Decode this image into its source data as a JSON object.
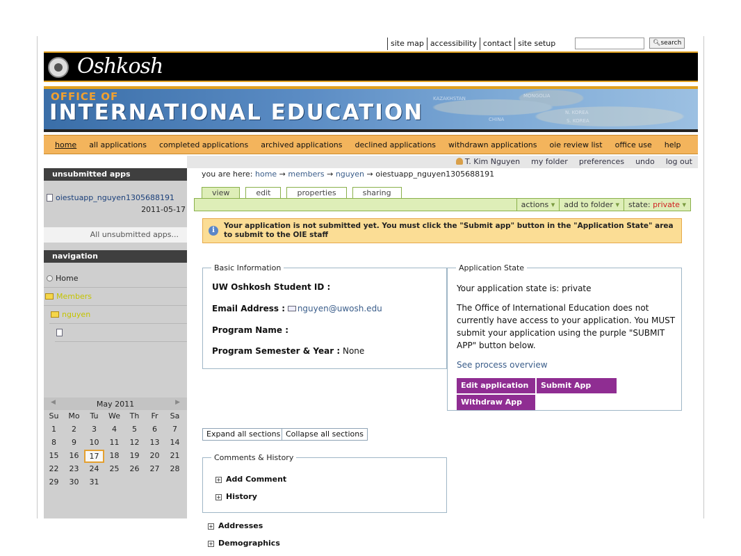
{
  "util": {
    "links": [
      "site map",
      "accessibility",
      "contact",
      "site setup"
    ],
    "search_button": "search",
    "search_placeholder": ""
  },
  "logo": {
    "text": "Oshkosh"
  },
  "banner": {
    "line1": "OFFICE OF",
    "line2": "INTERNATIONAL EDUCATION",
    "map_words": [
      "KAZAKHSTAN",
      "MONGOLIA",
      "N. KOREA",
      "S. KOREA",
      "CHINA"
    ]
  },
  "nav": {
    "items": [
      "home",
      "all applications",
      "completed applications",
      "archived applications",
      "declined applications",
      "withdrawn applications",
      "oie review list",
      "office use",
      "help"
    ]
  },
  "personal": {
    "user": "T. Kim Nguyen",
    "links": [
      "my folder",
      "preferences",
      "undo",
      "log out"
    ]
  },
  "left": {
    "unsubmitted_title": "unsubmitted apps",
    "unsubmitted_item": "oiestuapp_nguyen1305688191",
    "unsubmitted_date": "2011-05-17",
    "all_unsubmitted": "All unsubmitted apps...",
    "navigation_title": "navigation",
    "tree": [
      "Home",
      "Members",
      "nguyen",
      ""
    ]
  },
  "calendar": {
    "month": "May 2011",
    "days": [
      "Su",
      "Mo",
      "Tu",
      "We",
      "Th",
      "Fr",
      "Sa"
    ],
    "dates": [
      "1",
      "2",
      "3",
      "4",
      "5",
      "6",
      "7",
      "8",
      "9",
      "10",
      "11",
      "12",
      "13",
      "14",
      "15",
      "16",
      "17",
      "18",
      "19",
      "20",
      "21",
      "22",
      "23",
      "24",
      "25",
      "26",
      "27",
      "28",
      "29",
      "30",
      "31"
    ],
    "today": "17"
  },
  "breadcrumb": {
    "prefix": "you are here:",
    "items": [
      "home",
      "members",
      "nguyen"
    ],
    "current": "oiestuapp_nguyen1305688191"
  },
  "tabs": [
    "view",
    "edit",
    "properties",
    "sharing"
  ],
  "actions": {
    "actions_label": "actions",
    "add_to_folder": "add to folder",
    "state_label": "state:",
    "state_value": "private"
  },
  "info": {
    "message": "Your application is not submitted yet. You must click the \"Submit app\" button in the \"Application State\" area to submit to the OIE staff"
  },
  "basic": {
    "legend": "Basic Information",
    "student_id_label": "UW Oshkosh Student ID :",
    "email_label": "Email Address :",
    "email_value": "nguyen@uwosh.edu",
    "program_name_label": "Program Name :",
    "semester_label": "Program Semester & Year :",
    "semester_value": "None"
  },
  "app_state": {
    "legend": "Application State",
    "status": "Your application state is: private",
    "description": "The Office of International Education does not currently have access to your application. You MUST submit your application using the purple \"SUBMIT APP\" button below.",
    "overview_link": "See process overview",
    "edit_button": "Edit application",
    "submit_button": "Submit App",
    "withdraw_button": "Withdraw App"
  },
  "sections": {
    "expand": "Expand all sections",
    "collapse": "Collapse all sections",
    "comments_legend": "Comments & History",
    "add_comment": "Add Comment",
    "history": "History",
    "addresses": "Addresses",
    "demographics": "Demographics"
  },
  "colors": {
    "nav_orange": "#f3b45c",
    "purple_button": "#8f2d92",
    "state_red": "#d02020",
    "tab_green": "#deeeb8"
  }
}
